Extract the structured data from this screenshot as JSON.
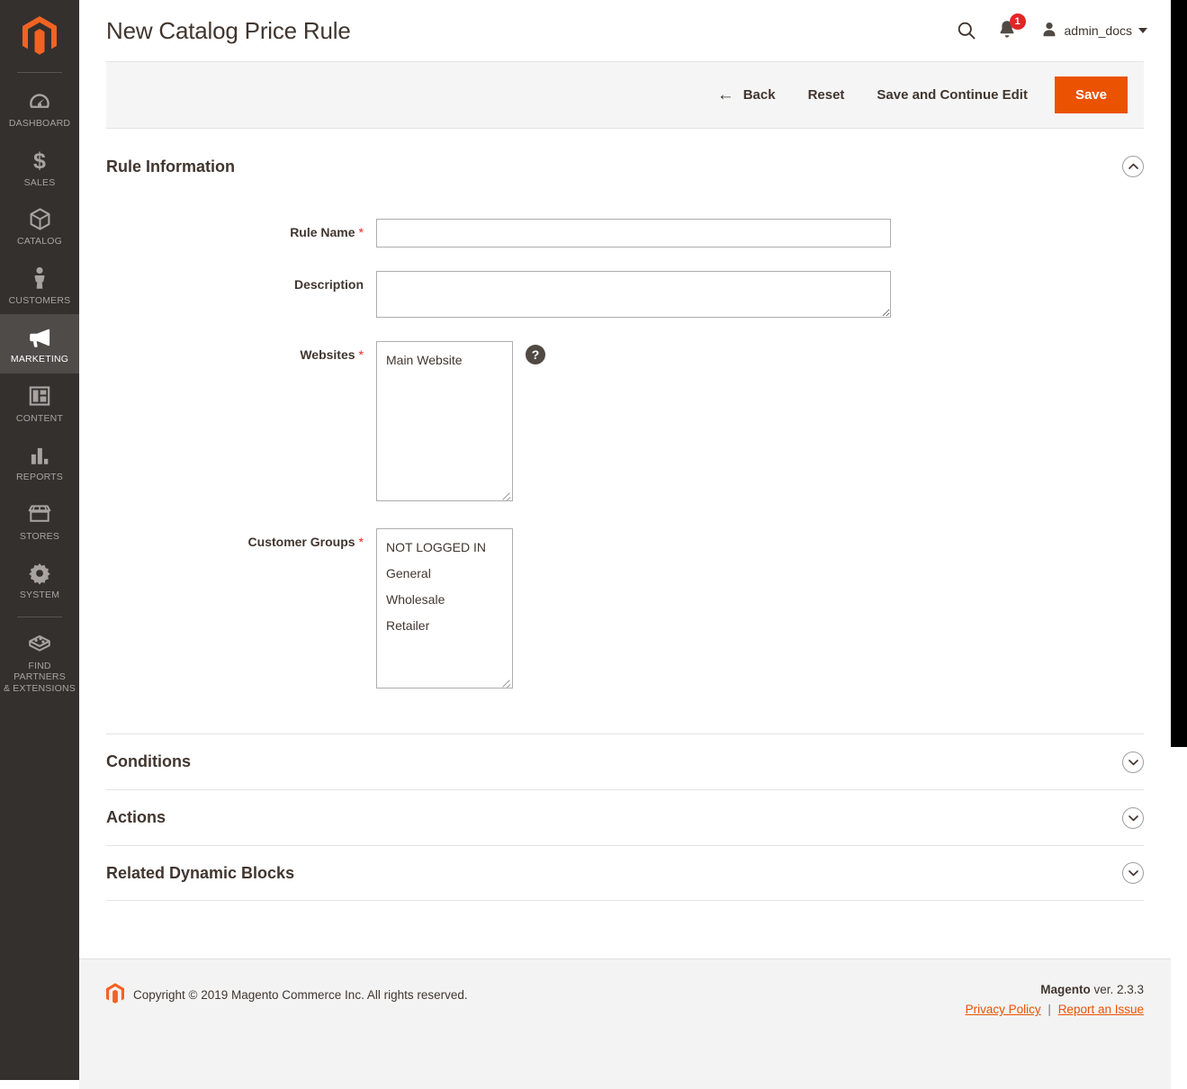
{
  "sidebar": {
    "logo_icon": "magento-logo-icon",
    "items": [
      {
        "id": "dashboard",
        "label": "DASHBOARD",
        "icon": "dashboard-gauge-icon",
        "active": false
      },
      {
        "id": "sales",
        "label": "SALES",
        "icon": "dollar-sign-icon",
        "active": false
      },
      {
        "id": "catalog",
        "label": "CATALOG",
        "icon": "box-icon",
        "active": false
      },
      {
        "id": "customers",
        "label": "CUSTOMERS",
        "icon": "person-icon",
        "active": false
      },
      {
        "id": "marketing",
        "label": "MARKETING",
        "icon": "megaphone-icon",
        "active": true
      },
      {
        "id": "content",
        "label": "CONTENT",
        "icon": "layout-panel-icon",
        "active": false
      },
      {
        "id": "reports",
        "label": "REPORTS",
        "icon": "bar-chart-icon",
        "active": false
      },
      {
        "id": "stores",
        "label": "STORES",
        "icon": "storefront-icon",
        "active": false
      },
      {
        "id": "system",
        "label": "SYSTEM",
        "icon": "gear-icon",
        "active": false
      },
      {
        "id": "find-partners",
        "label": "FIND PARTNERS\n& EXTENSIONS",
        "label_line1": "FIND PARTNERS",
        "label_line2": "& EXTENSIONS",
        "icon": "extensions-blocks-icon",
        "active": false
      }
    ]
  },
  "header": {
    "title": "New Catalog Price Rule",
    "search_icon": "search-icon",
    "notifications": {
      "icon": "bell-icon",
      "count": "1"
    },
    "user": {
      "icon": "user-avatar-icon",
      "name": "admin_docs",
      "caret": "chevron-down-icon"
    }
  },
  "page_actions": {
    "back_label": "Back",
    "back_icon": "arrow-left-icon",
    "reset_label": "Reset",
    "save_continue_label": "Save and Continue Edit",
    "save_label": "Save",
    "save_color": "#eb5202"
  },
  "rule_information": {
    "title": "Rule Information",
    "toggle_icon": "chevron-up-icon",
    "expanded": true,
    "fields": {
      "rule_name": {
        "label": "Rule Name",
        "required": true,
        "value": "",
        "placeholder": ""
      },
      "description": {
        "label": "Description",
        "required": false,
        "value": "",
        "placeholder": ""
      },
      "websites": {
        "label": "Websites",
        "required": true,
        "options": [
          "Main Website"
        ],
        "help_icon": "help-question-icon"
      },
      "customer_groups": {
        "label": "Customer Groups",
        "required": true,
        "options": [
          "NOT LOGGED IN",
          "General",
          "Wholesale",
          "Retailer"
        ]
      }
    }
  },
  "collapsed_sections": [
    {
      "id": "conditions",
      "title": "Conditions",
      "toggle_icon": "chevron-down-icon"
    },
    {
      "id": "actions",
      "title": "Actions",
      "toggle_icon": "chevron-down-icon"
    },
    {
      "id": "related-dynamic-blocks",
      "title": "Related Dynamic Blocks",
      "toggle_icon": "chevron-down-icon"
    }
  ],
  "footer": {
    "logo_icon": "magento-logo-icon",
    "copyright": "Copyright © 2019 Magento Commerce Inc. All rights reserved.",
    "brand": "Magento",
    "version": " ver. 2.3.3",
    "privacy_link": "Privacy Policy",
    "separator": "|",
    "issue_link": "Report an Issue"
  },
  "colors": {
    "accent": "#eb5202",
    "sidebar_bg": "#33302e",
    "sidebar_active_bg": "#4f4b48",
    "text": "#41362f",
    "required_star": "#e22626",
    "badge": "#e22626"
  }
}
